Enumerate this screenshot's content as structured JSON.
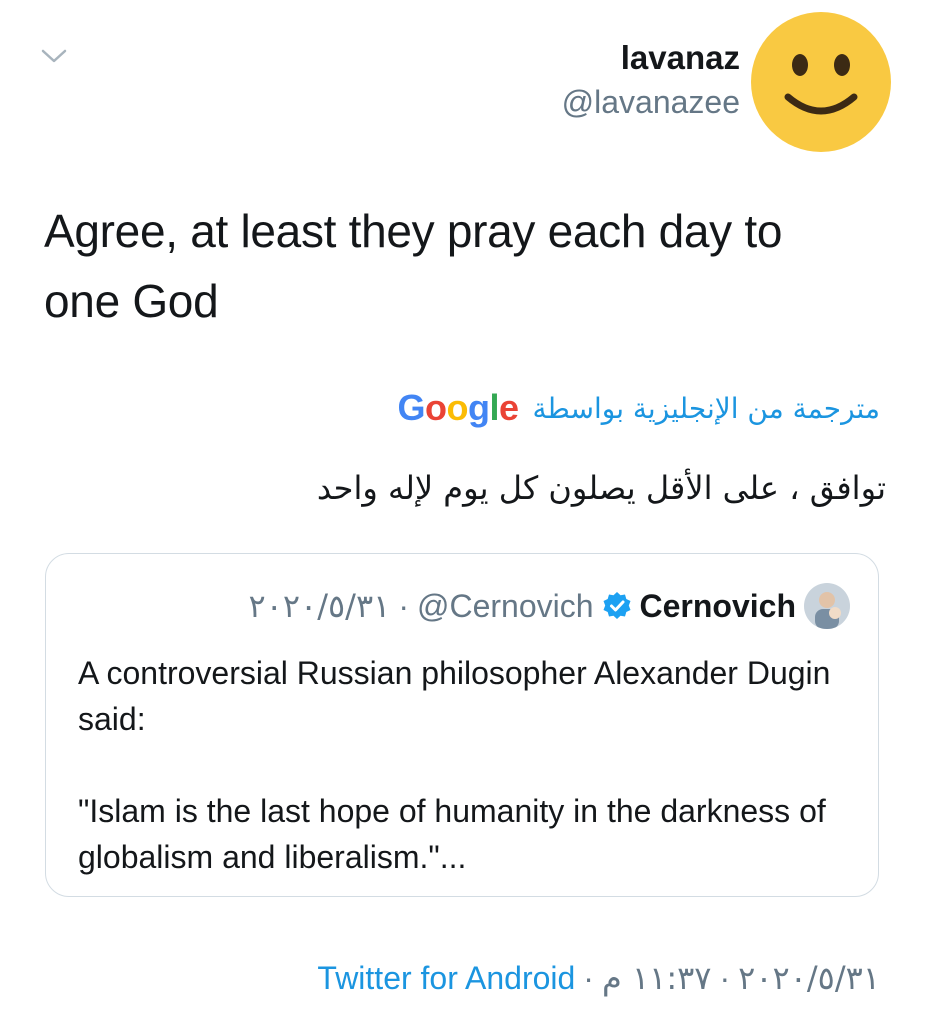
{
  "tweet": {
    "author": {
      "name": "lavanaz",
      "handle": "@lavanazee",
      "avatar_icon": "smiley-face-emoji"
    },
    "text": "Agree, at least they pray each day to one God",
    "translation_label": "مترجمة من الإنجليزية بواسطة",
    "translation_provider": "Google",
    "translation": "توافق ، على الأقل يصلون كل يوم لإله واحد",
    "timestamp": {
      "date": "٢٠٢٠/٥/٣١",
      "time": "١١:٣٧ م",
      "separator": "·",
      "source": "Twitter for Android"
    }
  },
  "quoted_tweet": {
    "name": "Cernovich",
    "handle": "@Cernovich",
    "date": "٢٠٢٠/٥/٣١",
    "separator": "·",
    "verified_icon": "verified-badge-icon",
    "text": "A controversial Russian philosopher Alexander Dugin said:\n\n\"Islam is the last hope of humanity in the darkness of globalism and liberalism.\"..."
  },
  "colors": {
    "link_blue": "#1b95e0",
    "secondary_text": "#657786",
    "border": "#d3dce3",
    "emoji_yellow": "#f9c942"
  },
  "icons": {
    "menu": "chevron-down-icon"
  }
}
